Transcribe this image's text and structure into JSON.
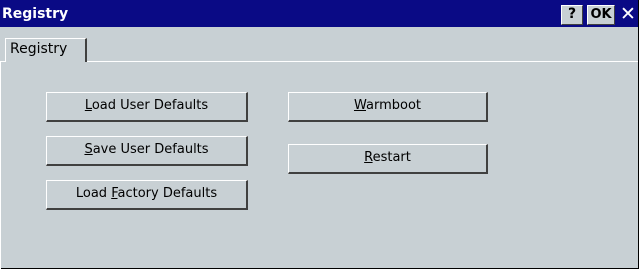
{
  "window": {
    "title": "Registry",
    "help_label": "?",
    "ok_label": "OK",
    "close_glyph": "✕"
  },
  "tabs": [
    {
      "label": "Registry",
      "selected": true
    }
  ],
  "buttons": {
    "load_user_defaults": {
      "pre": "",
      "key": "L",
      "post": "oad User Defaults"
    },
    "save_user_defaults": {
      "pre": "",
      "key": "S",
      "post": "ave User Defaults"
    },
    "load_factory_defaults": {
      "pre": "Load ",
      "key": "F",
      "post": "actory Defaults"
    },
    "warmboot": {
      "pre": "",
      "key": "W",
      "post": "armboot"
    },
    "restart": {
      "pre": "",
      "key": "R",
      "post": "estart"
    }
  },
  "colors": {
    "titlebar": "#0a0a85",
    "face": "#c8d0d4"
  }
}
